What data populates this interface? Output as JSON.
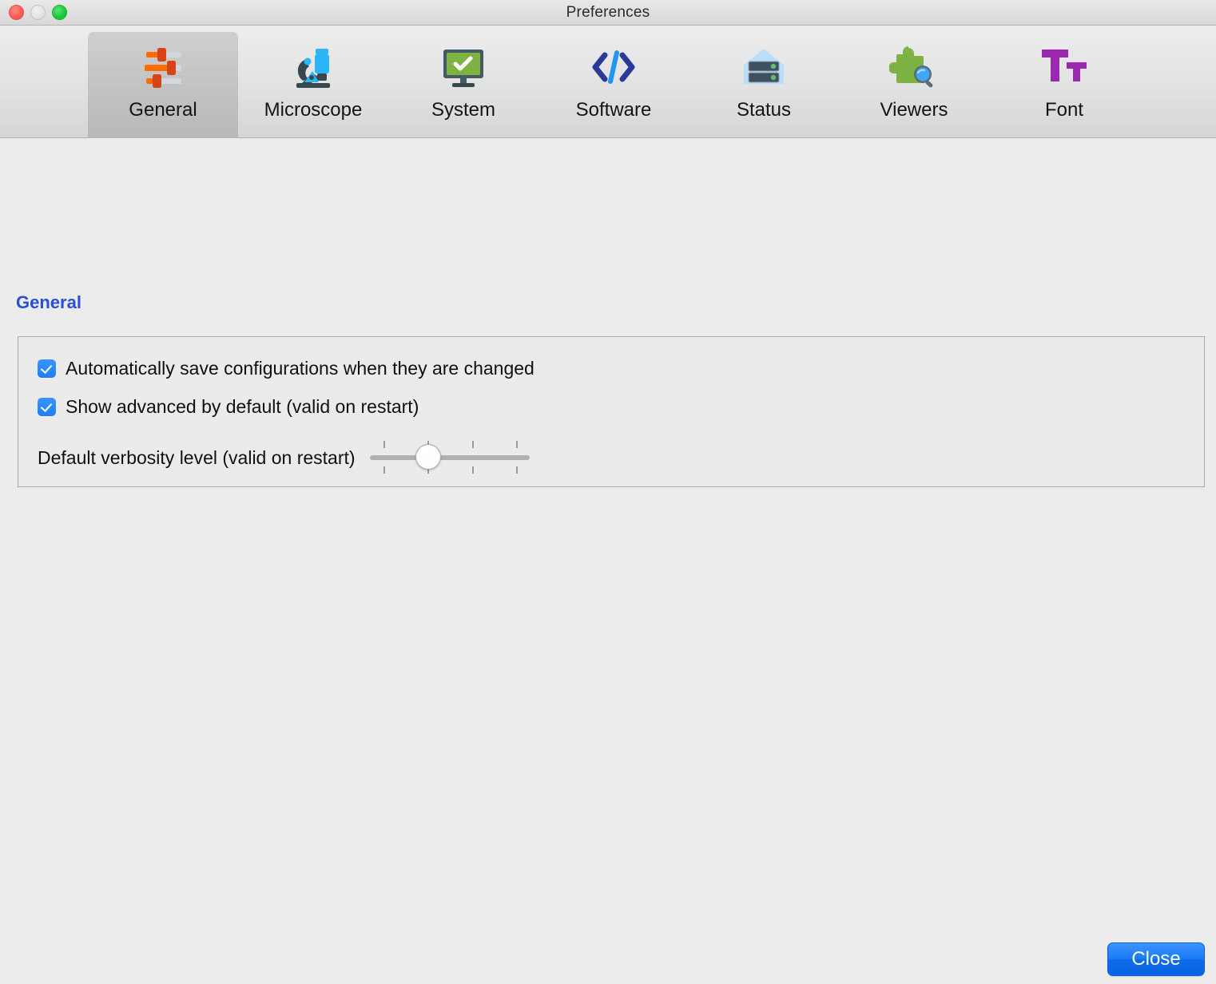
{
  "window": {
    "title": "Preferences",
    "traffic_lights": [
      {
        "name": "close",
        "color": "#ff6057"
      },
      {
        "name": "minimize",
        "color": "#e3e3e3"
      },
      {
        "name": "zoom",
        "color": "#1fc93c"
      }
    ]
  },
  "toolbar": {
    "tabs": [
      {
        "label": "General",
        "icon": "sliders-icon",
        "selected": true
      },
      {
        "label": "Microscope",
        "icon": "microscope-icon",
        "selected": false
      },
      {
        "label": "System",
        "icon": "monitor-check-icon",
        "selected": false
      },
      {
        "label": "Software",
        "icon": "code-brackets-icon",
        "selected": false
      },
      {
        "label": "Status",
        "icon": "server-rack-icon",
        "selected": false
      },
      {
        "label": "Viewers",
        "icon": "puzzle-search-icon",
        "selected": false
      },
      {
        "label": "Font",
        "icon": "font-size-icon",
        "selected": false
      }
    ]
  },
  "content": {
    "section_title": "General",
    "section_title_color": "#2a4fd6",
    "checkboxes": [
      {
        "label": "Automatically save configurations when they are changed",
        "checked": true
      },
      {
        "label": "Show advanced by default (valid on restart)",
        "checked": true
      }
    ],
    "slider": {
      "label": "Default verbosity level (valid on restart)",
      "tick_count": 4,
      "value_index": 1,
      "min": 0,
      "max": 3
    }
  },
  "footer": {
    "close_label": "Close",
    "close_color": "#1a7cf5"
  }
}
